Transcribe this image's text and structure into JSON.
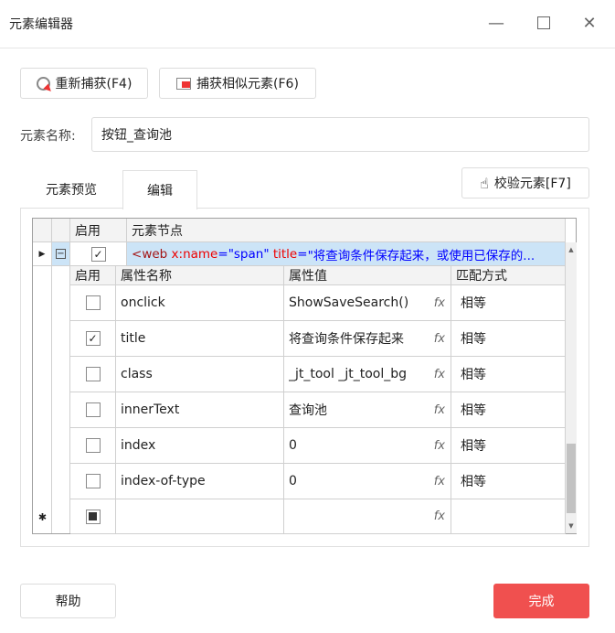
{
  "window": {
    "title": "元素编辑器"
  },
  "toolbar": {
    "recapture": "重新捕获(F4)",
    "capture_similar": "捕获相似元素(F6)"
  },
  "name_field": {
    "label": "元素名称:",
    "value": "按钮_查询池"
  },
  "tabs": [
    {
      "label": "元素预览",
      "active": false
    },
    {
      "label": "编辑",
      "active": true
    }
  ],
  "validate_button": "校验元素[F7]",
  "grid": {
    "headers": {
      "enabled": "启用",
      "node": "元素节点"
    },
    "node": {
      "enabled": true,
      "lt": "<",
      "tag": "web",
      "attr1_prefix": "x:",
      "attr1_name": "name",
      "eq": "=",
      "attr1_value": "\"span\"",
      "attr2_name": "title",
      "attr2_value": "\"将查询条件保存起来，或使用已保存的..."
    },
    "sub_headers": {
      "enabled": "启用",
      "name": "属性名称",
      "value": "属性值",
      "match": "匹配方式"
    },
    "rows": [
      {
        "enabled": false,
        "name": "onclick",
        "value": "ShowSaveSearch()",
        "match": "相等"
      },
      {
        "enabled": true,
        "name": "title",
        "value": "将查询条件保存起来",
        "match": "相等"
      },
      {
        "enabled": false,
        "name": "class",
        "value": "_jt_tool _jt_tool_bg",
        "match": "相等"
      },
      {
        "enabled": false,
        "name": "innerText",
        "value": "查询池",
        "match": "相等"
      },
      {
        "enabled": false,
        "name": "index",
        "value": "0",
        "match": "相等"
      },
      {
        "enabled": false,
        "name": "index-of-type",
        "value": "0",
        "match": "相等"
      }
    ],
    "fx_label": "fx",
    "new_row_marker": "✱"
  },
  "footer": {
    "help": "帮助",
    "finish": "完成"
  },
  "colors": {
    "accent": "#f0504f",
    "selected_row": "#cce4f7"
  }
}
